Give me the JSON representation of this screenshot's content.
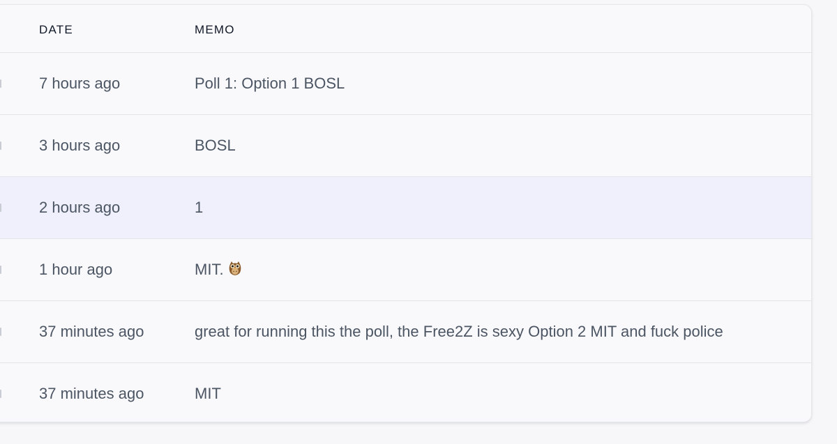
{
  "table": {
    "columns": {
      "date": "DATE",
      "memo": "MEMO"
    },
    "rows": [
      {
        "date": "7 hours ago",
        "memo": "Poll 1: Option 1 BOSL"
      },
      {
        "date": "3 hours ago",
        "memo": "BOSL"
      },
      {
        "date": "2 hours ago",
        "memo": "1"
      },
      {
        "date": "1 hour ago",
        "memo": "MIT.",
        "memo_emoji": "owl-icon"
      },
      {
        "date": "37 minutes ago",
        "memo": "great for running this the poll, the Free2Z is sexy Option 2 MIT and fuck police"
      },
      {
        "date": "37 minutes ago",
        "memo": "MIT"
      }
    ],
    "highlighted_row_index": 2,
    "colors": {
      "page_background": "#f7f7f9",
      "card_background": "#f9f9fb",
      "highlight_background": "#eff0fc",
      "header_text": "#111827",
      "cell_text": "#4b5563",
      "divider": "#e3e4e8"
    }
  }
}
